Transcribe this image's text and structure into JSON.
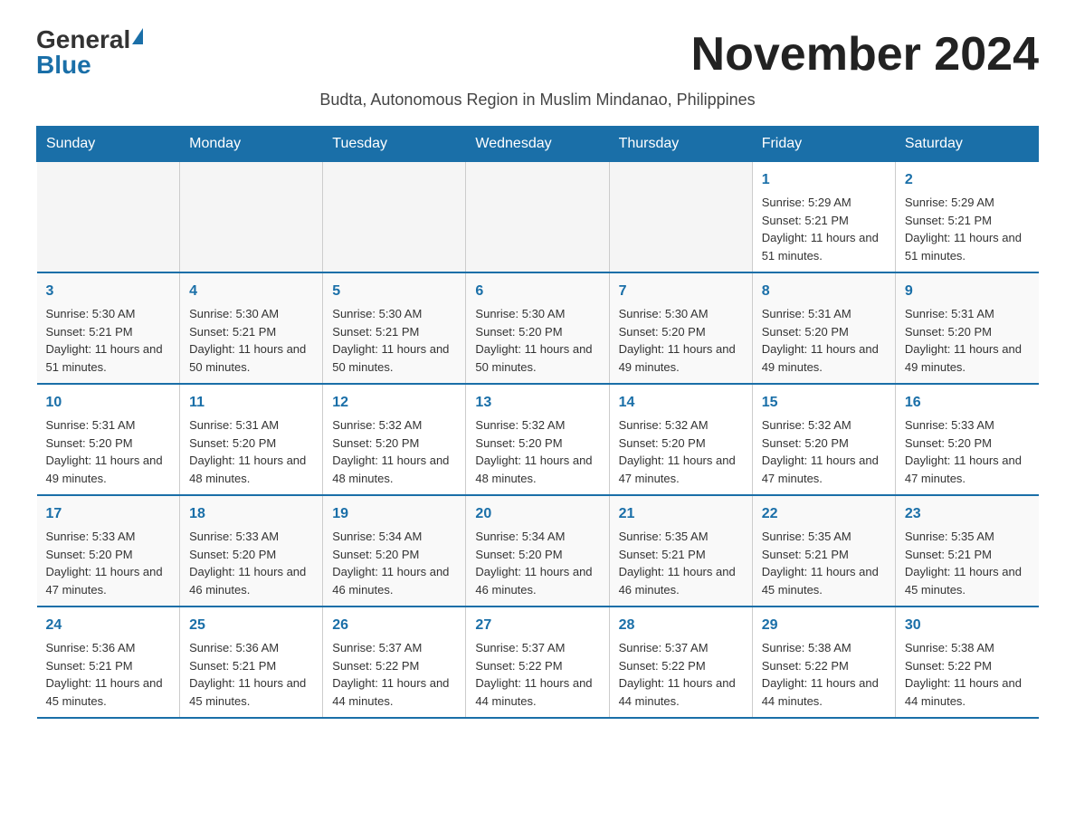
{
  "header": {
    "logo_general": "General",
    "logo_blue": "Blue",
    "month_title": "November 2024",
    "subtitle": "Budta, Autonomous Region in Muslim Mindanao, Philippines"
  },
  "days_of_week": [
    "Sunday",
    "Monday",
    "Tuesday",
    "Wednesday",
    "Thursday",
    "Friday",
    "Saturday"
  ],
  "weeks": [
    [
      {
        "day": "",
        "info": ""
      },
      {
        "day": "",
        "info": ""
      },
      {
        "day": "",
        "info": ""
      },
      {
        "day": "",
        "info": ""
      },
      {
        "day": "",
        "info": ""
      },
      {
        "day": "1",
        "info": "Sunrise: 5:29 AM\nSunset: 5:21 PM\nDaylight: 11 hours and 51 minutes."
      },
      {
        "day": "2",
        "info": "Sunrise: 5:29 AM\nSunset: 5:21 PM\nDaylight: 11 hours and 51 minutes."
      }
    ],
    [
      {
        "day": "3",
        "info": "Sunrise: 5:30 AM\nSunset: 5:21 PM\nDaylight: 11 hours and 51 minutes."
      },
      {
        "day": "4",
        "info": "Sunrise: 5:30 AM\nSunset: 5:21 PM\nDaylight: 11 hours and 50 minutes."
      },
      {
        "day": "5",
        "info": "Sunrise: 5:30 AM\nSunset: 5:21 PM\nDaylight: 11 hours and 50 minutes."
      },
      {
        "day": "6",
        "info": "Sunrise: 5:30 AM\nSunset: 5:20 PM\nDaylight: 11 hours and 50 minutes."
      },
      {
        "day": "7",
        "info": "Sunrise: 5:30 AM\nSunset: 5:20 PM\nDaylight: 11 hours and 49 minutes."
      },
      {
        "day": "8",
        "info": "Sunrise: 5:31 AM\nSunset: 5:20 PM\nDaylight: 11 hours and 49 minutes."
      },
      {
        "day": "9",
        "info": "Sunrise: 5:31 AM\nSunset: 5:20 PM\nDaylight: 11 hours and 49 minutes."
      }
    ],
    [
      {
        "day": "10",
        "info": "Sunrise: 5:31 AM\nSunset: 5:20 PM\nDaylight: 11 hours and 49 minutes."
      },
      {
        "day": "11",
        "info": "Sunrise: 5:31 AM\nSunset: 5:20 PM\nDaylight: 11 hours and 48 minutes."
      },
      {
        "day": "12",
        "info": "Sunrise: 5:32 AM\nSunset: 5:20 PM\nDaylight: 11 hours and 48 minutes."
      },
      {
        "day": "13",
        "info": "Sunrise: 5:32 AM\nSunset: 5:20 PM\nDaylight: 11 hours and 48 minutes."
      },
      {
        "day": "14",
        "info": "Sunrise: 5:32 AM\nSunset: 5:20 PM\nDaylight: 11 hours and 47 minutes."
      },
      {
        "day": "15",
        "info": "Sunrise: 5:32 AM\nSunset: 5:20 PM\nDaylight: 11 hours and 47 minutes."
      },
      {
        "day": "16",
        "info": "Sunrise: 5:33 AM\nSunset: 5:20 PM\nDaylight: 11 hours and 47 minutes."
      }
    ],
    [
      {
        "day": "17",
        "info": "Sunrise: 5:33 AM\nSunset: 5:20 PM\nDaylight: 11 hours and 47 minutes."
      },
      {
        "day": "18",
        "info": "Sunrise: 5:33 AM\nSunset: 5:20 PM\nDaylight: 11 hours and 46 minutes."
      },
      {
        "day": "19",
        "info": "Sunrise: 5:34 AM\nSunset: 5:20 PM\nDaylight: 11 hours and 46 minutes."
      },
      {
        "day": "20",
        "info": "Sunrise: 5:34 AM\nSunset: 5:20 PM\nDaylight: 11 hours and 46 minutes."
      },
      {
        "day": "21",
        "info": "Sunrise: 5:35 AM\nSunset: 5:21 PM\nDaylight: 11 hours and 46 minutes."
      },
      {
        "day": "22",
        "info": "Sunrise: 5:35 AM\nSunset: 5:21 PM\nDaylight: 11 hours and 45 minutes."
      },
      {
        "day": "23",
        "info": "Sunrise: 5:35 AM\nSunset: 5:21 PM\nDaylight: 11 hours and 45 minutes."
      }
    ],
    [
      {
        "day": "24",
        "info": "Sunrise: 5:36 AM\nSunset: 5:21 PM\nDaylight: 11 hours and 45 minutes."
      },
      {
        "day": "25",
        "info": "Sunrise: 5:36 AM\nSunset: 5:21 PM\nDaylight: 11 hours and 45 minutes."
      },
      {
        "day": "26",
        "info": "Sunrise: 5:37 AM\nSunset: 5:22 PM\nDaylight: 11 hours and 44 minutes."
      },
      {
        "day": "27",
        "info": "Sunrise: 5:37 AM\nSunset: 5:22 PM\nDaylight: 11 hours and 44 minutes."
      },
      {
        "day": "28",
        "info": "Sunrise: 5:37 AM\nSunset: 5:22 PM\nDaylight: 11 hours and 44 minutes."
      },
      {
        "day": "29",
        "info": "Sunrise: 5:38 AM\nSunset: 5:22 PM\nDaylight: 11 hours and 44 minutes."
      },
      {
        "day": "30",
        "info": "Sunrise: 5:38 AM\nSunset: 5:22 PM\nDaylight: 11 hours and 44 minutes."
      }
    ]
  ]
}
